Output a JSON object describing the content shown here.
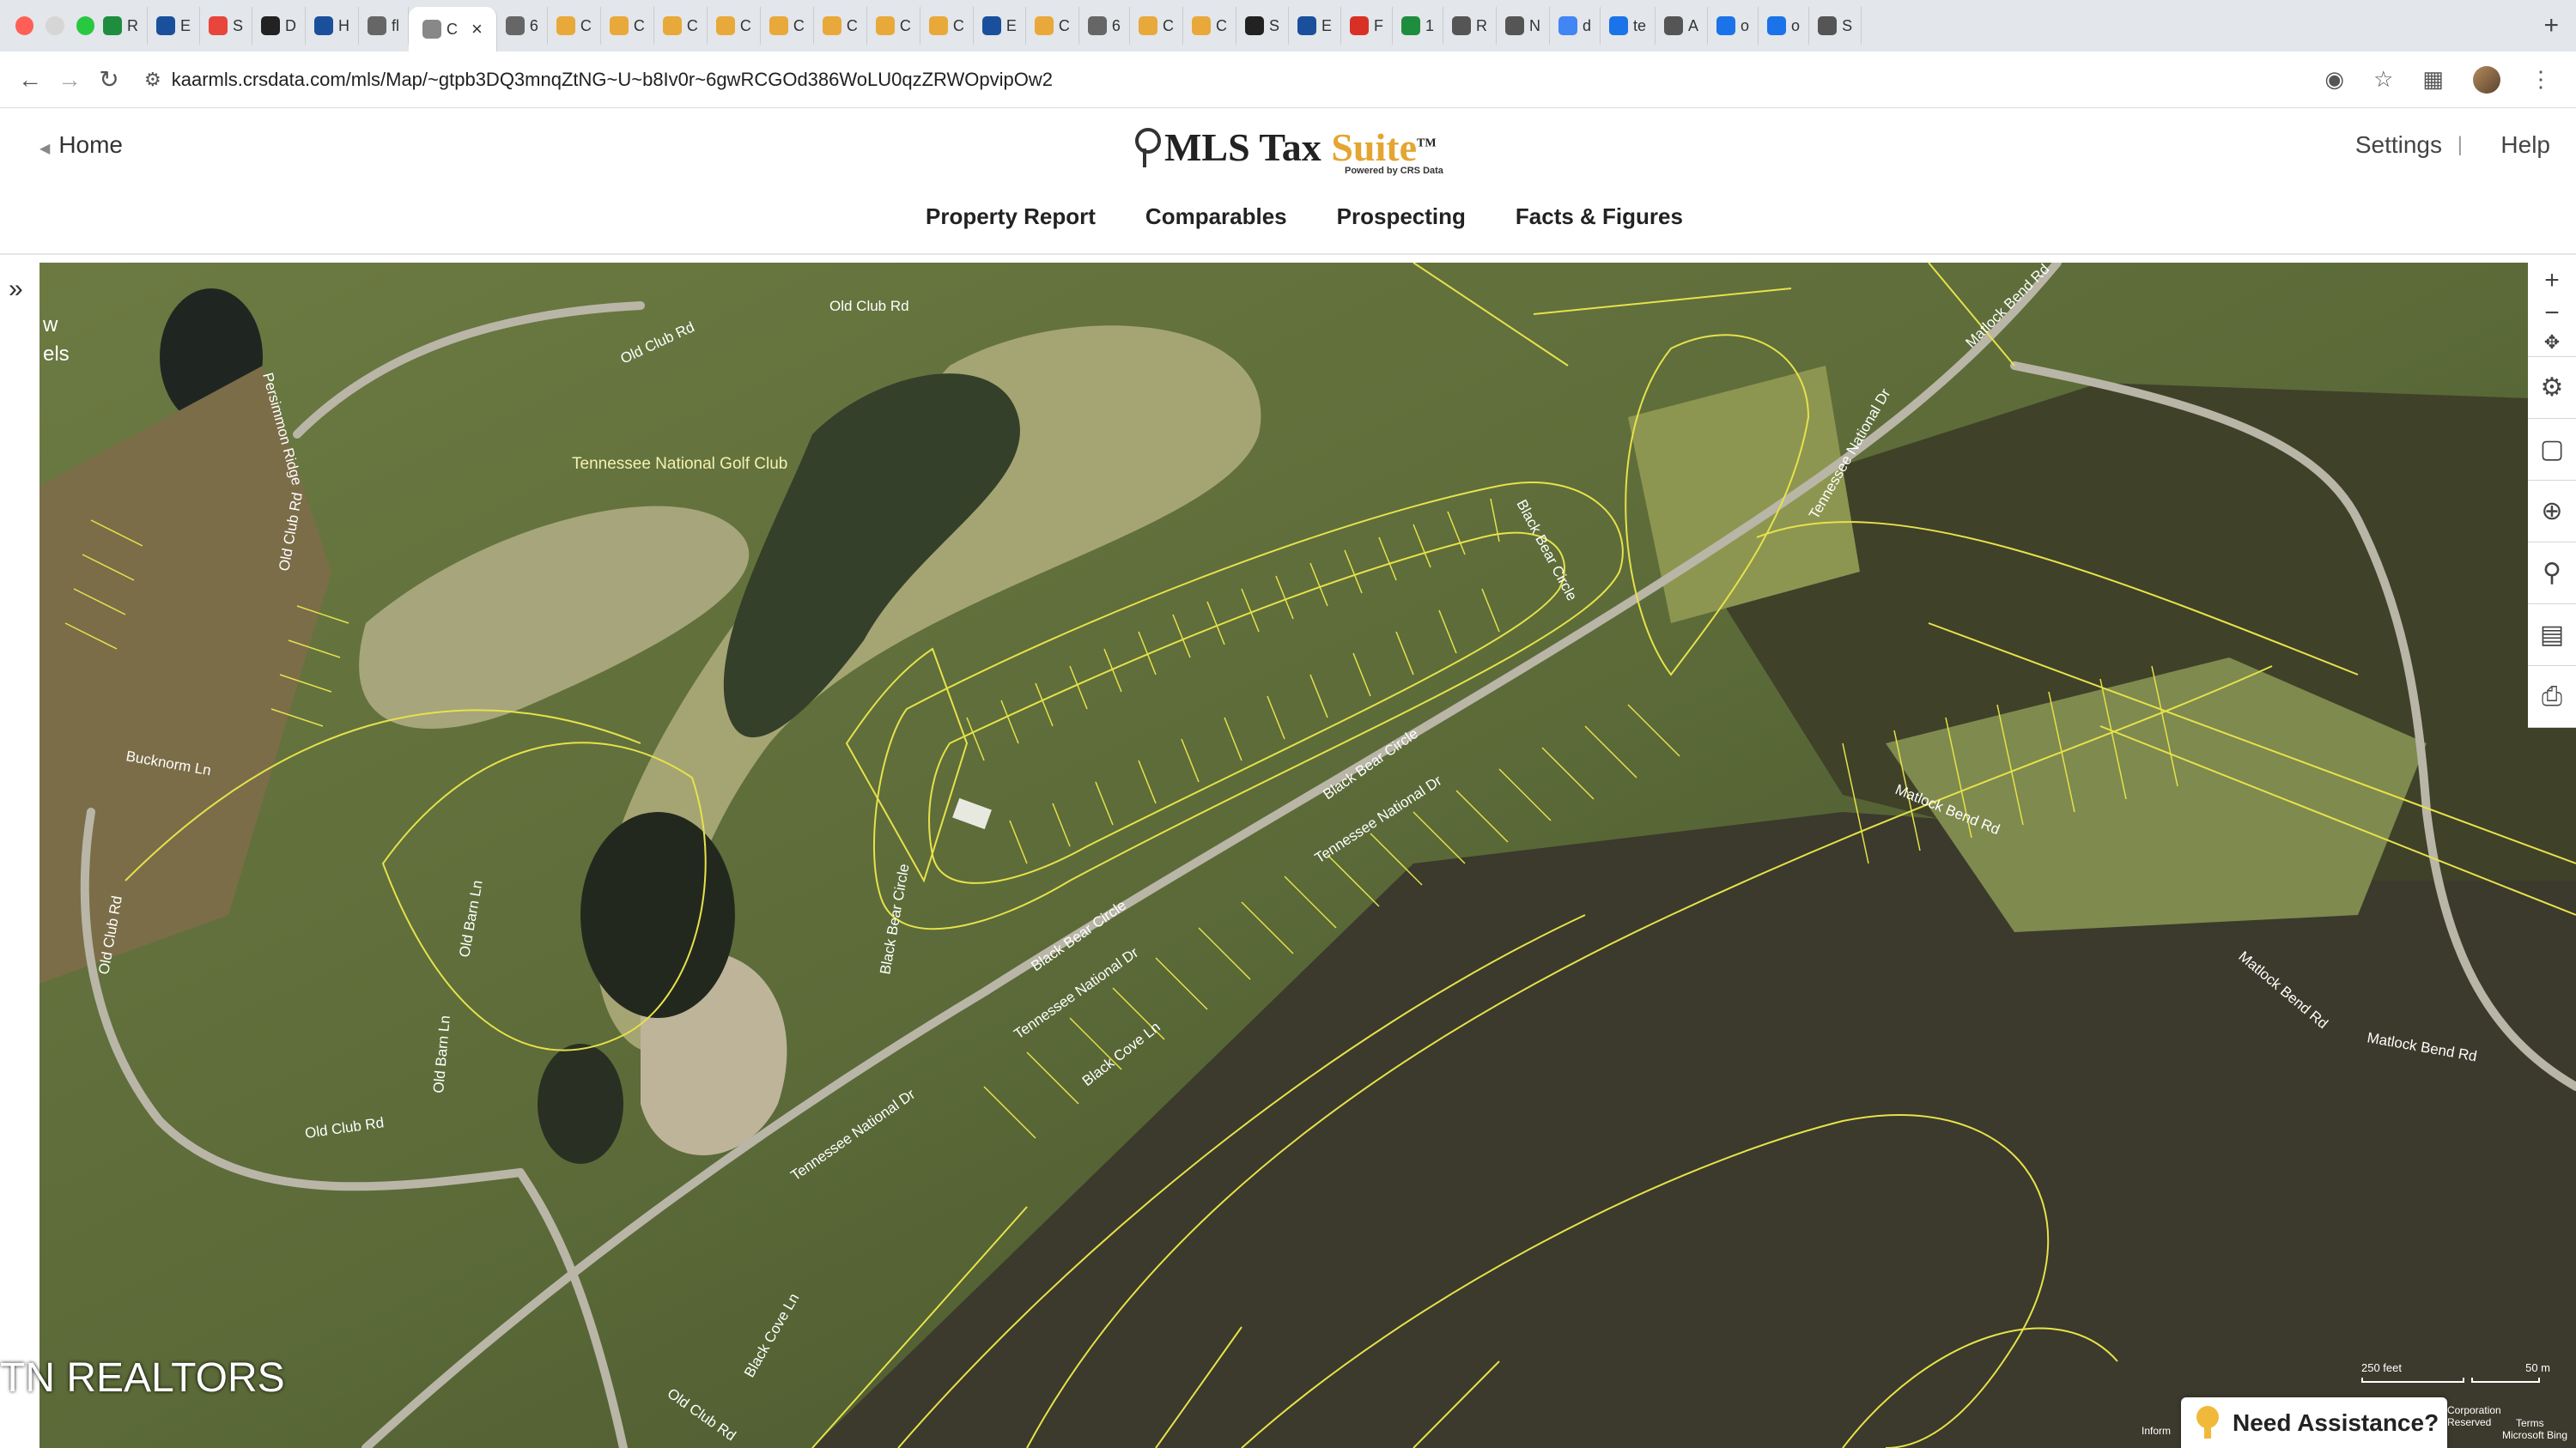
{
  "browser": {
    "tabs": [
      {
        "label": "R",
        "color": "#1e8e3e"
      },
      {
        "label": "E",
        "color": "#1a4f9c"
      },
      {
        "label": "S",
        "color": "#e8453c"
      },
      {
        "label": "D",
        "color": "#222222"
      },
      {
        "label": "H",
        "color": "#1a4f9c"
      },
      {
        "label": "fl",
        "color": "#666666"
      },
      {
        "label": "C",
        "color": "#888888",
        "active": true
      },
      {
        "label": "6",
        "color": "#666666"
      },
      {
        "label": "C",
        "color": "#e8a93a"
      },
      {
        "label": "C",
        "color": "#e8a93a"
      },
      {
        "label": "C",
        "color": "#e8a93a"
      },
      {
        "label": "C",
        "color": "#e8a93a"
      },
      {
        "label": "C",
        "color": "#e8a93a"
      },
      {
        "label": "C",
        "color": "#e8a93a"
      },
      {
        "label": "C",
        "color": "#e8a93a"
      },
      {
        "label": "C",
        "color": "#e8a93a"
      },
      {
        "label": "E",
        "color": "#1a4f9c"
      },
      {
        "label": "C",
        "color": "#e8a93a"
      },
      {
        "label": "6",
        "color": "#666666"
      },
      {
        "label": "C",
        "color": "#e8a93a"
      },
      {
        "label": "C",
        "color": "#e8a93a"
      },
      {
        "label": "S",
        "color": "#222222"
      },
      {
        "label": "E",
        "color": "#1a4f9c"
      },
      {
        "label": "F",
        "color": "#d93025"
      },
      {
        "label": "1",
        "color": "#1e8e3e"
      },
      {
        "label": "R",
        "color": "#555555"
      },
      {
        "label": "N",
        "color": "#555555"
      },
      {
        "label": "d",
        "color": "#4285f4"
      },
      {
        "label": "te",
        "color": "#1a73e8"
      },
      {
        "label": "A",
        "color": "#555555"
      },
      {
        "label": "o",
        "color": "#1a73e8"
      },
      {
        "label": "o",
        "color": "#1a73e8"
      },
      {
        "label": "S",
        "color": "#555555"
      }
    ],
    "url": "kaarmls.crsdata.com/mls/Map/~gtpb3DQ3mnqZtNG~U~b8Iv0r~6gwRCGOd386WoLU0qzZRWOpvipOw2"
  },
  "header": {
    "home_label": "Home",
    "brand_mls": "MLS Tax",
    "brand_suite": "Suite",
    "brand_tm": "TM",
    "powered_by": "Powered by CRS Data",
    "settings_label": "Settings",
    "separator": "|",
    "help_label": "Help",
    "nav": [
      "Property Report",
      "Comparables",
      "Prospecting",
      "Facts & Figures"
    ]
  },
  "map": {
    "poi": "Tennessee National Golf Club",
    "roads": [
      "Old Club Rd",
      "Old Club Rd",
      "Old Club Rd",
      "Old Club Rd",
      "Old Club Rd",
      "Old Club Rd",
      "Black Bear Circle",
      "Black Bear Circle",
      "Black Bear Circle",
      "Black Bear Circle",
      "Tennessee National Dr",
      "Tennessee National Dr",
      "Tennessee National Dr",
      "Tennessee National Dr",
      "Matlock Bend Rd",
      "Matlock Bend Rd",
      "Matlock Bend Rd",
      "Matlock Bend Rd",
      "Black Cove Ln",
      "Black Cove Ln",
      "Bucknorm Ln",
      "Old Barn Ln",
      "Old Barn Ln",
      "Persimmon Ridge"
    ],
    "left_overlay": [
      "w",
      "els"
    ],
    "watermark": "TN REALTORS",
    "scale": {
      "feet": "250 feet",
      "meters": "50 m"
    },
    "attribution": "Inform",
    "attribution2": [
      "Corporation",
      "Reserved",
      "Terms",
      "Microsoft Bing"
    ],
    "assist_label": "Need Assistance?"
  }
}
